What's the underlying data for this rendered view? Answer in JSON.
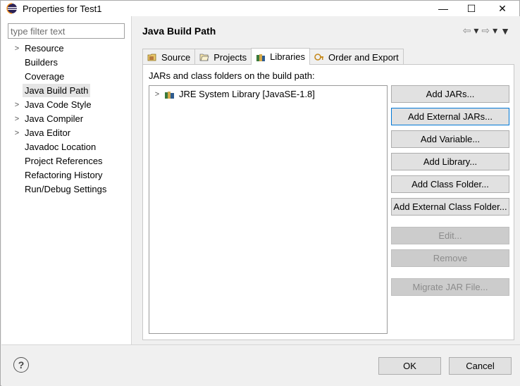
{
  "window": {
    "title": "Properties for Test1",
    "minimize_glyph": "—",
    "maximize_glyph": "☐",
    "close_glyph": "✕"
  },
  "sidebar": {
    "filter_placeholder": "type filter text",
    "items": [
      {
        "label": "Resource",
        "expandable": true
      },
      {
        "label": "Builders",
        "expandable": false
      },
      {
        "label": "Coverage",
        "expandable": false
      },
      {
        "label": "Java Build Path",
        "expandable": false,
        "selected": true
      },
      {
        "label": "Java Code Style",
        "expandable": true
      },
      {
        "label": "Java Compiler",
        "expandable": true
      },
      {
        "label": "Java Editor",
        "expandable": true
      },
      {
        "label": "Javadoc Location",
        "expandable": false
      },
      {
        "label": "Project References",
        "expandable": false
      },
      {
        "label": "Refactoring History",
        "expandable": false
      },
      {
        "label": "Run/Debug Settings",
        "expandable": false
      }
    ]
  },
  "main": {
    "title": "Java Build Path",
    "nav": {
      "back": "⇦",
      "forward": "⇨",
      "dropdown": "▾",
      "menu": "▼"
    },
    "tabs": [
      {
        "label": "Source",
        "icon": "source-folder-icon"
      },
      {
        "label": "Projects",
        "icon": "projects-folder-icon"
      },
      {
        "label": "Libraries",
        "icon": "libraries-icon",
        "active": true
      },
      {
        "label": "Order and Export",
        "icon": "order-export-icon"
      }
    ],
    "section_label": "JARs and class folders on the build path:",
    "libraries": [
      {
        "label": "JRE System Library [JavaSE-1.8]",
        "icon": "library-icon"
      }
    ],
    "buttons": {
      "add_jars": "Add JARs...",
      "add_external_jars": "Add External JARs...",
      "add_variable": "Add Variable...",
      "add_library": "Add Library...",
      "add_class_folder": "Add Class Folder...",
      "add_external_class_folder": "Add External Class Folder...",
      "edit": "Edit...",
      "remove": "Remove",
      "migrate_jar": "Migrate JAR File..."
    }
  },
  "footer": {
    "help": "?",
    "ok": "OK",
    "cancel": "Cancel"
  },
  "colors": {
    "focus_border": "#0078d7",
    "dialog_bg": "#f0f0f0",
    "selected_item_bg": "#e5e5e5"
  }
}
